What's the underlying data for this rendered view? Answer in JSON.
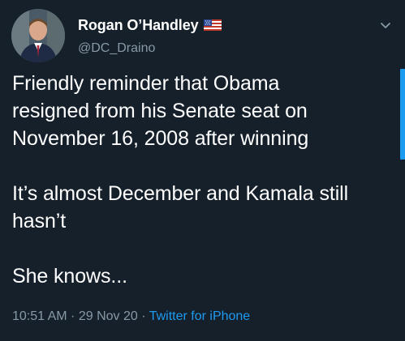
{
  "user": {
    "display_name": "Rogan O’Handley",
    "handle": "@DC_Draino",
    "flag_icon": "us-flag-icon"
  },
  "tweet": {
    "text": "Friendly reminder that Obama\nresigned from his Senate seat on\nNovember 16, 2008 after winning\n\nIt’s almost December and Kamala still\nhasn’t\n\nShe knows...",
    "time": "10:51 AM",
    "separator": " · ",
    "date": "29 Nov 20",
    "source": "Twitter for iPhone"
  },
  "colors": {
    "background": "#15202b",
    "secondary_text": "#8899a6",
    "accent": "#1d9bf0"
  }
}
